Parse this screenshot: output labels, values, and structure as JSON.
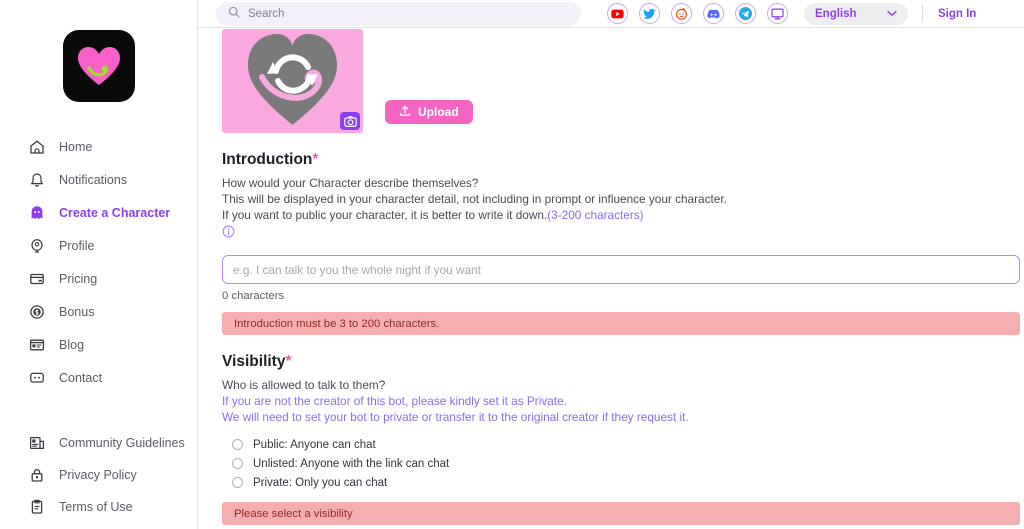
{
  "brand": {
    "logo_icon": "pink-heart-logo",
    "accent_purple": "#8b3ff0",
    "accent_pink": "#f564c0",
    "error_bg": "#f5aeae"
  },
  "sidebar": {
    "items": [
      {
        "label": "Home",
        "icon": "home-icon",
        "active": false
      },
      {
        "label": "Notifications",
        "icon": "bell-icon",
        "active": false
      },
      {
        "label": "Create a Character",
        "icon": "ghost-icon",
        "active": true
      },
      {
        "label": "Profile",
        "icon": "user-badge-icon",
        "active": false
      },
      {
        "label": "Pricing",
        "icon": "credit-card-icon",
        "active": false
      },
      {
        "label": "Bonus",
        "icon": "coin-dollar-icon",
        "active": false
      },
      {
        "label": "Blog",
        "icon": "article-icon",
        "active": false
      },
      {
        "label": "Contact",
        "icon": "chat-bubble-icon",
        "active": false
      }
    ],
    "bottom_items": [
      {
        "label": "Community Guidelines",
        "icon": "news-icon"
      },
      {
        "label": "Privacy Policy",
        "icon": "lock-icon"
      },
      {
        "label": "Terms of Use",
        "icon": "clipboard-icon"
      }
    ]
  },
  "header": {
    "search": {
      "placeholder": "Search",
      "value": "",
      "icon": "search-icon"
    },
    "socials": [
      {
        "name": "youtube-icon",
        "color": "#ff0000"
      },
      {
        "name": "twitter-icon",
        "color": "#1da1f2"
      },
      {
        "name": "reddit-icon",
        "color": "#ff4500"
      },
      {
        "name": "discord-icon",
        "color": "#5865f2"
      },
      {
        "name": "telegram-icon",
        "color": "#29a9eb"
      },
      {
        "name": "monitor-icon",
        "color": "#8b3ff0"
      }
    ],
    "language": {
      "label": "English",
      "chevron": "chevron-down-icon"
    },
    "sign_in": "Sign In"
  },
  "avatar": {
    "placeholder_icon": "heart-refresh-icon",
    "camera_badge_icon": "camera-icon",
    "upload_button": {
      "label": "Upload",
      "icon": "upload-icon"
    }
  },
  "introduction": {
    "title": "Introduction",
    "required_mark": "*",
    "desc_line1": "How would your Character describe themselves?",
    "desc_line2": "This will be displayed in your character detail, not including in prompt or influence your character.",
    "desc_line3": "If you want to public your character, it is better to write it down.",
    "char_range": "(3-200 characters)",
    "info_icon": "info-circle-icon",
    "input": {
      "placeholder": "e.g. I can talk to you the whole night if you want",
      "value": ""
    },
    "char_count": "0 characters",
    "error": "Introduction must be 3 to 200 characters."
  },
  "visibility": {
    "title": "Visibility",
    "required_mark": "*",
    "desc_line1": "Who is allowed to talk to them?",
    "desc_purple1": "If you are not the creator of this bot, please kindly set it as Private.",
    "desc_purple2": "We will need to set your bot to private or transfer it to the original creator if they request it.",
    "options": [
      {
        "label": "Public: Anyone can chat",
        "selected": false
      },
      {
        "label": "Unlisted: Anyone with the link can chat",
        "selected": false
      },
      {
        "label": "Private: Only you can chat",
        "selected": false
      }
    ],
    "error": "Please select a visibility"
  }
}
